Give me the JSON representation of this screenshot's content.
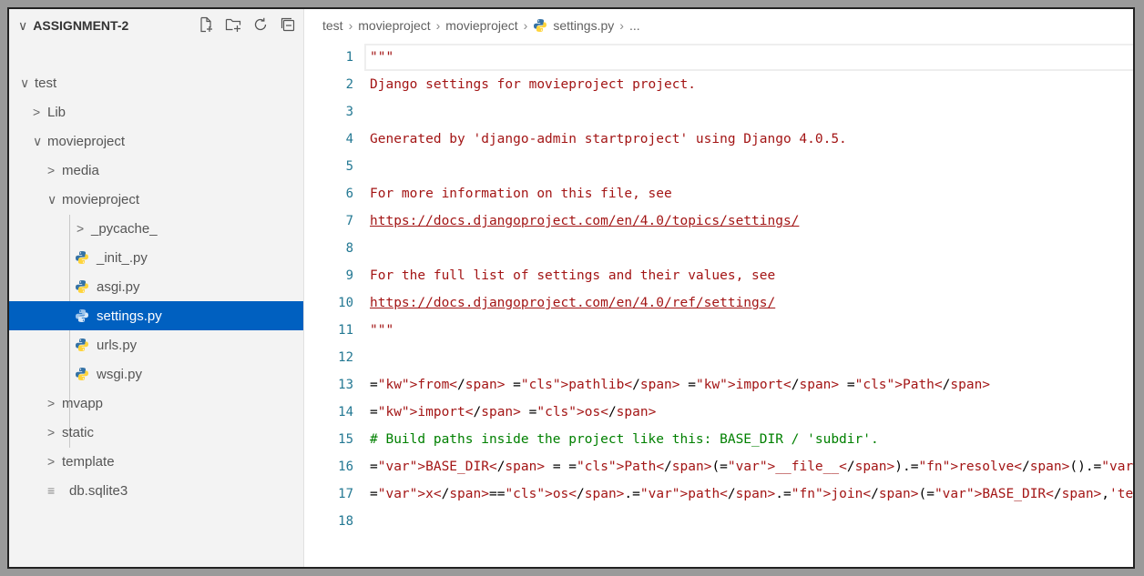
{
  "explorer": {
    "title": "ASSIGNMENT-2",
    "actions": [
      "new-file-icon",
      "new-folder-icon",
      "refresh-icon",
      "collapse-all-icon"
    ],
    "tree": [
      {
        "label": "test",
        "type": "folder",
        "expanded": true,
        "depth": 1
      },
      {
        "label": "Lib",
        "type": "folder",
        "expanded": false,
        "depth": 2
      },
      {
        "label": "movieproject",
        "type": "folder",
        "expanded": true,
        "depth": 2
      },
      {
        "label": "media",
        "type": "folder",
        "expanded": false,
        "depth": 3
      },
      {
        "label": "movieproject",
        "type": "folder",
        "expanded": true,
        "depth": 3
      },
      {
        "label": "_pycache_",
        "type": "folder",
        "expanded": false,
        "depth": 4
      },
      {
        "label": "_init_.py",
        "type": "python",
        "depth": 4
      },
      {
        "label": "asgi.py",
        "type": "python",
        "depth": 4
      },
      {
        "label": "settings.py",
        "type": "python",
        "depth": 4,
        "selected": true
      },
      {
        "label": "urls.py",
        "type": "python",
        "depth": 4
      },
      {
        "label": "wsgi.py",
        "type": "python",
        "depth": 4
      },
      {
        "label": "mvapp",
        "type": "folder",
        "expanded": false,
        "depth": 3
      },
      {
        "label": "static",
        "type": "folder",
        "expanded": false,
        "depth": 3
      },
      {
        "label": "template",
        "type": "folder",
        "expanded": false,
        "depth": 3
      },
      {
        "label": "db.sqlite3",
        "type": "db",
        "depth": 3
      }
    ]
  },
  "breadcrumb": {
    "parts": [
      "test",
      "movieproject",
      "movieproject"
    ],
    "file": "settings.py",
    "tail": "..."
  },
  "code": [
    {
      "n": "1",
      "text": "\"\"\""
    },
    {
      "n": "2",
      "text": "Django settings for movieproject project."
    },
    {
      "n": "3",
      "text": ""
    },
    {
      "n": "4",
      "text": "Generated by 'django-admin startproject' using Django 4.0.5."
    },
    {
      "n": "5",
      "text": ""
    },
    {
      "n": "6",
      "text": "For more information on this file, see"
    },
    {
      "n": "7",
      "text": "https://docs.djangoproject.com/en/4.0/topics/settings/"
    },
    {
      "n": "8",
      "text": ""
    },
    {
      "n": "9",
      "text": "For the full list of settings and their values, see"
    },
    {
      "n": "10",
      "text": "https://docs.djangoproject.com/en/4.0/ref/settings/"
    },
    {
      "n": "11",
      "text": "\"\"\""
    },
    {
      "n": "12",
      "text": ""
    },
    {
      "n": "13",
      "text": "from pathlib import Path"
    },
    {
      "n": "14",
      "text": "import os"
    },
    {
      "n": "15",
      "text": "# Build paths inside the project like this: BASE_DIR / 'subdir'."
    },
    {
      "n": "16",
      "text": "BASE_DIR = Path(__file__).resolve().parent.parent"
    },
    {
      "n": "17",
      "text": "x=os.path.join(BASE_DIR,'template')"
    },
    {
      "n": "18",
      "text": ""
    }
  ],
  "colors": {
    "selection": "#0060c0",
    "string": "#a31515",
    "keyword": "#af00db",
    "comment": "#008000",
    "line_number": "#237893",
    "python_blue": "#3572A5",
    "python_yellow": "#FFD43B"
  }
}
